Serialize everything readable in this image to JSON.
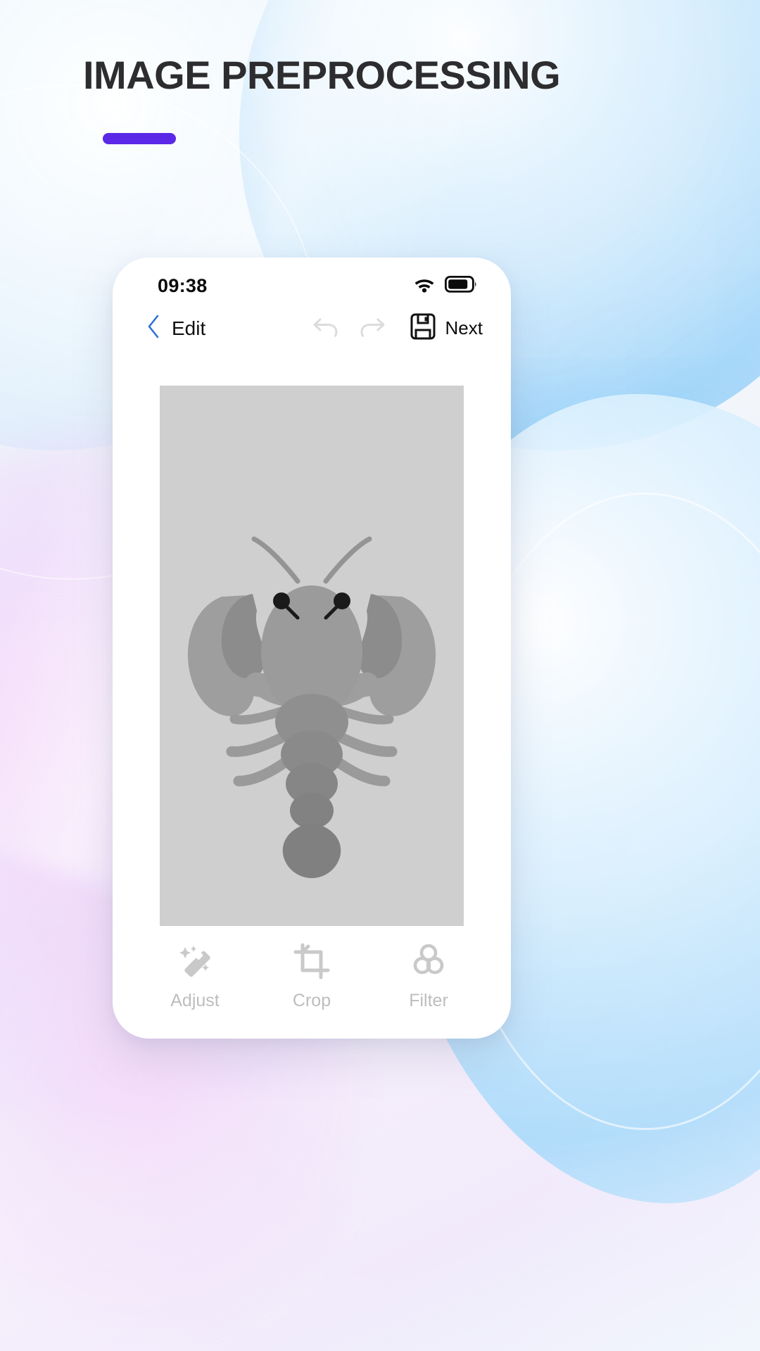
{
  "heading": {
    "title": "IMAGE PREPROCESSING",
    "accent_color": "#5a28e6"
  },
  "phone": {
    "status_bar": {
      "time": "09:38",
      "wifi_icon": "wifi-icon",
      "battery_icon": "battery-icon"
    },
    "edit_toolbar": {
      "back_icon": "chevron-left-icon",
      "title": "Edit",
      "undo_icon": "undo-arrow-icon",
      "redo_icon": "redo-arrow-icon",
      "save_icon": "floppy-disk-save-icon",
      "next_label": "Next",
      "back_color": "#2f72d8",
      "disabled_color": "#dcdcdc"
    },
    "preview": {
      "background_color": "#cfcfcf",
      "subject": "lobster-illustration",
      "shades": {
        "light": "#9e9e9e",
        "mid": "#8c8c8c",
        "dark": "#7d7d7d",
        "eye": "#1a1a1a"
      }
    },
    "bottom_toolbar": {
      "items": [
        {
          "label": "Adjust",
          "icon": "magic-wand-icon"
        },
        {
          "label": "Crop",
          "icon": "crop-icon"
        },
        {
          "label": "Filter",
          "icon": "filter-circles-icon"
        }
      ],
      "inactive_color": "#c9c9c9"
    }
  }
}
